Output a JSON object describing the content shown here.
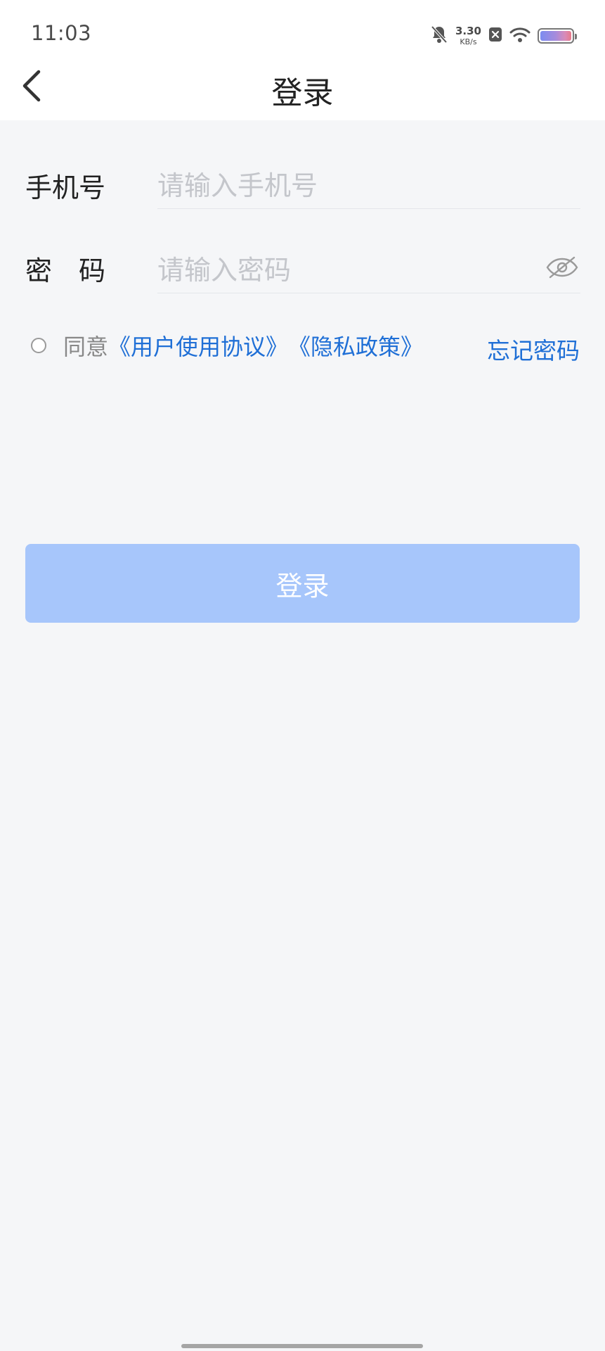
{
  "status_bar": {
    "time": "11:03",
    "net_speed_value": "3.30",
    "net_speed_unit": "KB/s",
    "icons": [
      "bell-off-icon",
      "close-box-icon",
      "wifi-icon",
      "battery-icon"
    ]
  },
  "nav": {
    "title": "登录",
    "back_icon": "chevron-left-icon"
  },
  "form": {
    "phone_label": "手机号",
    "phone_placeholder": "请输入手机号",
    "phone_value": "",
    "password_label": "密　码",
    "password_placeholder": "请输入密码",
    "password_value": "",
    "eye_icon": "eye-hidden-icon"
  },
  "agreement": {
    "prefix": "同意",
    "user_agreement": "《用户使用协议》",
    "privacy_policy": "《隐私政策》",
    "checked": false
  },
  "forgot_password": "忘记密码",
  "login_button": "登录",
  "colors": {
    "link": "#1f6fd6",
    "button_disabled": "#a7c6fb",
    "background": "#f5f6f8"
  }
}
